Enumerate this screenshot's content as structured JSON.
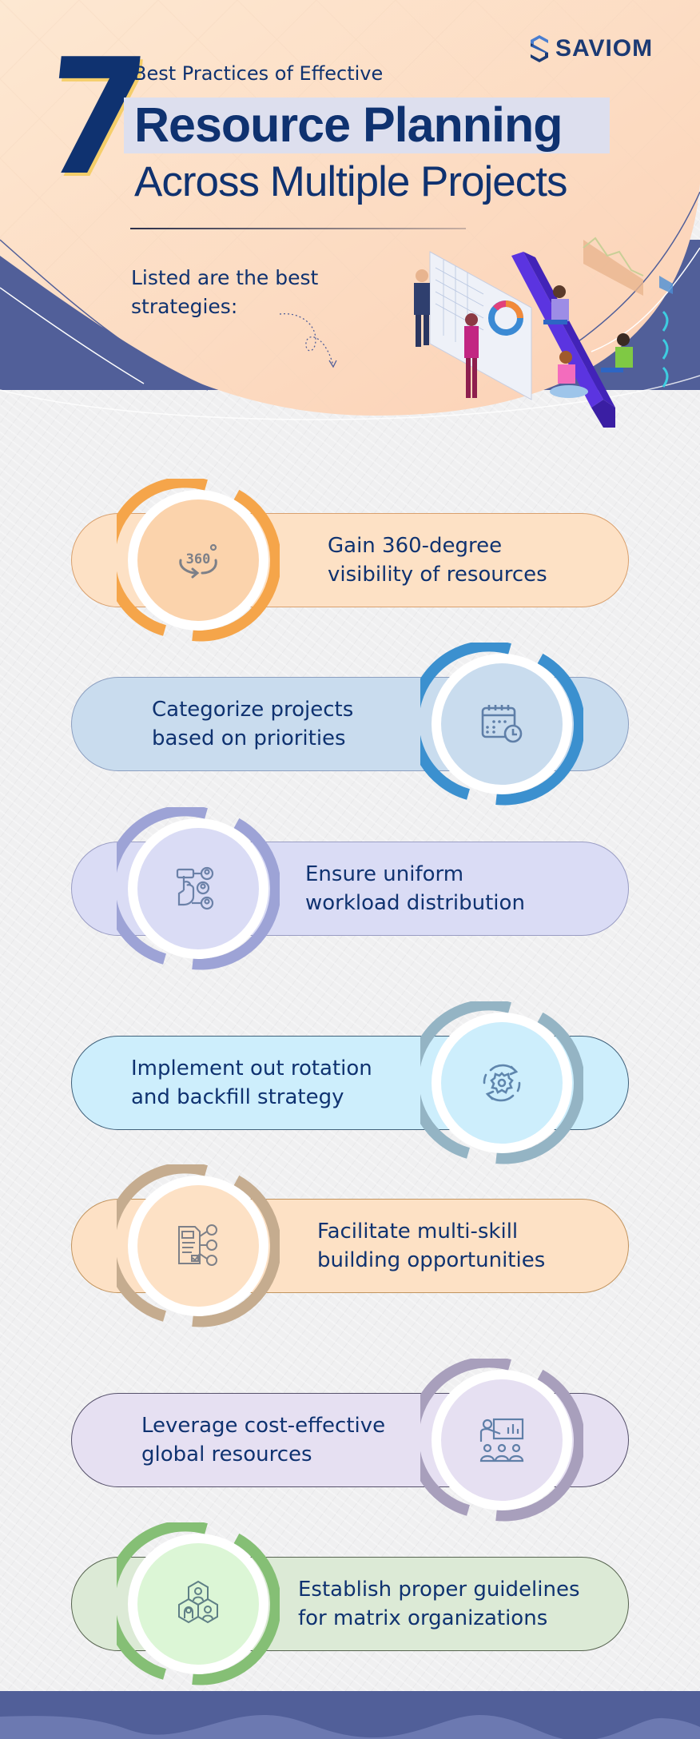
{
  "brand": {
    "name": "SAVIOM",
    "logo_icon": "saviom-s-icon",
    "color": "#1b3a74"
  },
  "header": {
    "number": "7",
    "subtitle": "Best Practices of Effective",
    "title": "Resource Planning",
    "title_sub": "Across Multiple Projects",
    "intro_line1": "Listed are the best",
    "intro_line2": "strategies:",
    "illustration": "team-analytics-illustration"
  },
  "colors": {
    "navy_text": "#0f3270",
    "header_peach": "#fcd8bd",
    "band_navy": "#515f99",
    "title_highlight": "#dddfee",
    "number_outline": "#f5ce6a"
  },
  "practices": [
    {
      "label_line1": "Gain 360-degree",
      "label_line2": "visibility of resources",
      "icon": "360-degree-icon",
      "side": "left",
      "pill_fill": "#fde1c5",
      "pill_border": "#d9a06e",
      "ring": "#f5a54a",
      "inner": "#fbd3ac"
    },
    {
      "label_line1": "Categorize projects",
      "label_line2": "based on priorities",
      "icon": "calendar-clock-icon",
      "side": "right",
      "pill_fill": "#c9dcee",
      "pill_border": "#8c9fc0",
      "ring": "#3b90cf",
      "inner": "#c9dcee"
    },
    {
      "label_line1": "Ensure uniform",
      "label_line2": "workload distribution",
      "icon": "workload-distribution-icon",
      "side": "left",
      "pill_fill": "#dadcf5",
      "pill_border": "#9a9dc4",
      "ring": "#9da3d6",
      "inner": "#dadcf5"
    },
    {
      "label_line1": "Implement out rotation",
      "label_line2": "and backfill strategy",
      "icon": "gear-rotation-icon",
      "side": "right",
      "pill_fill": "#cdeefc",
      "pill_border": "#3f607a",
      "ring": "#94b4c4",
      "inner": "#cdeefc"
    },
    {
      "label_line1": "Facilitate multi-skill",
      "label_line2": "building opportunities",
      "icon": "skills-checklist-icon",
      "side": "left",
      "pill_fill": "#fde1c5",
      "pill_border": "#c2945e",
      "ring": "#c5ac8f",
      "inner": "#fde1c5"
    },
    {
      "label_line1": "Leverage cost-effective",
      "label_line2": "global resources",
      "icon": "presentation-team-icon",
      "side": "right",
      "pill_fill": "#e6e0f2",
      "pill_border": "#55506a",
      "ring": "#a89fbc",
      "inner": "#e6e0f2"
    },
    {
      "label_line1": "Establish proper guidelines",
      "label_line2": "for matrix organizations",
      "icon": "matrix-team-icon",
      "side": "left",
      "pill_fill": "#dcead6",
      "pill_border": "#56634f",
      "ring": "#85bf75",
      "inner": "#dcf6d6"
    }
  ]
}
